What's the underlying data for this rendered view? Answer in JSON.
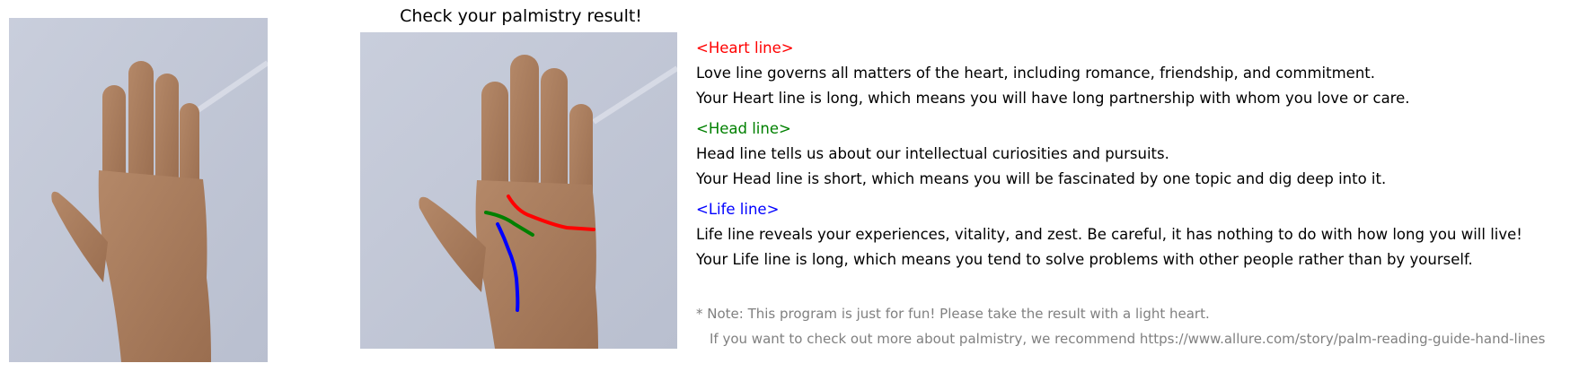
{
  "title": "Check your palmistry result!",
  "sections": [
    {
      "heading": "<Heart line>",
      "color": "#ff0000",
      "lines": [
        "Love line governs all matters of the heart, including romance, friendship, and commitment.",
        "Your Heart line is long, which means you will have long partnership with whom you love or care."
      ]
    },
    {
      "heading": "<Head line>",
      "color": "#008000",
      "lines": [
        "Head line tells us about our intellectual curiosities and pursuits.",
        "Your Head line is short, which means you will be fascinated by one topic and dig deep into it."
      ]
    },
    {
      "heading": "<Life line>",
      "color": "#0000ff",
      "lines": [
        "Life line reveals your experiences, vitality, and zest. Be careful, it has nothing to do with how long you will live!",
        "Your Life line is long, which means you tend to solve problems with other people rather than by yourself."
      ]
    }
  ],
  "note": {
    "line1": "* Note: This program is just for fun! Please take the result with a light heart.",
    "line2": "If you want to check out more about palmistry, we recommend https://www.allure.com/story/palm-reading-guide-hand-lines"
  }
}
